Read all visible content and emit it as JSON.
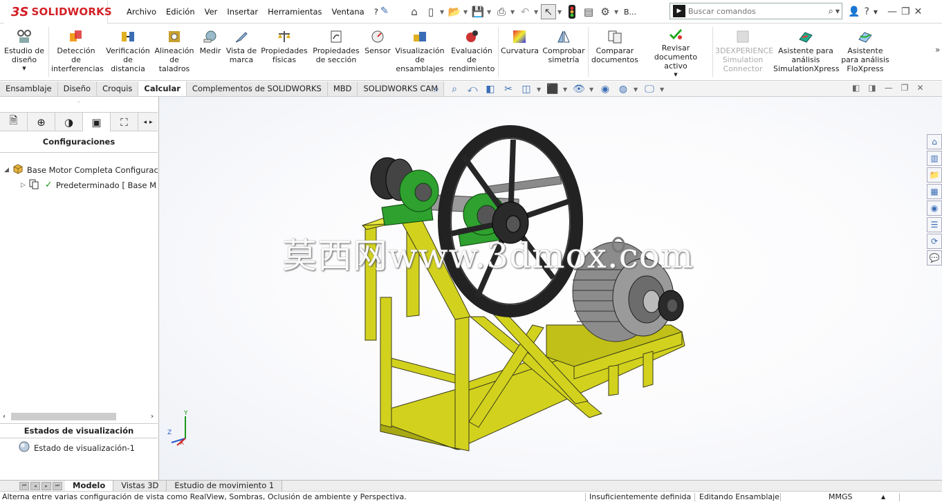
{
  "app": {
    "logo_ds": "3S",
    "logo_name": "SOLIDWORKS"
  },
  "menu": [
    "Archivo",
    "Edición",
    "Ver",
    "Insertar",
    "Herramientas",
    "Ventana",
    "?"
  ],
  "quick_toolbar": {
    "b_label": "B..."
  },
  "search": {
    "placeholder": "Buscar comandos"
  },
  "ribbon": {
    "items": [
      {
        "label": "Estudio de diseño",
        "icon": "design-study-icon"
      },
      {
        "label": "Detección de interferencias",
        "icon": "interference-icon"
      },
      {
        "label": "Verificación de distancia",
        "icon": "clearance-icon"
      },
      {
        "label": "Alineación de taladros",
        "icon": "hole-alignment-icon"
      },
      {
        "label": "Medir",
        "icon": "measure-icon"
      },
      {
        "label": "Vista de marca",
        "icon": "markup-icon"
      },
      {
        "label": "Propiedades físicas",
        "icon": "mass-properties-icon"
      },
      {
        "label": "Propiedades de sección",
        "icon": "section-properties-icon"
      },
      {
        "label": "Sensor",
        "icon": "sensor-icon"
      },
      {
        "label": "Visualización de ensamblajes",
        "icon": "assembly-visualization-icon"
      },
      {
        "label": "Evaluación de rendimiento",
        "icon": "performance-icon"
      },
      {
        "label": "Curvatura",
        "icon": "curvature-icon"
      },
      {
        "label": "Comprobar simetría",
        "icon": "symmetry-icon"
      },
      {
        "label": "Comparar documentos",
        "icon": "compare-icon"
      },
      {
        "label": "Revisar documento activo",
        "icon": "check-document-icon"
      },
      {
        "label": "3DEXPERIENCE Simulation Connector",
        "icon": "3dx-connector-icon"
      },
      {
        "label": "Asistente para análisis SimulationXpress",
        "icon": "simulationxpress-icon"
      },
      {
        "label": "Asistente para análisis FloXpress",
        "icon": "floxpress-icon"
      }
    ]
  },
  "command_tabs": [
    "Ensamblaje",
    "Diseño",
    "Croquis",
    "Calcular",
    "Complementos de SOLIDWORKS",
    "MBD",
    "SOLIDWORKS CAM"
  ],
  "active_command_tab": "Calcular",
  "left_panel": {
    "config_title": "Configuraciones",
    "tree": [
      {
        "label": "Base Motor Completa Configurac",
        "icon": "assembly-icon"
      },
      {
        "label": "Predeterminado [ Base M",
        "icon": "configuration-icon"
      }
    ],
    "display_states_title": "Estados de visualización",
    "display_state": "Estado de visualización-1"
  },
  "viewport": {
    "watermark": "莫西网www.3dmox.com",
    "triad_y": "Y",
    "triad_z": "Z",
    "triad_x": "X"
  },
  "bottom_tabs": [
    "Modelo",
    "Vistas 3D",
    "Estudio de movimiento 1"
  ],
  "active_bottom_tab": "Modelo",
  "status": {
    "message": "Alterna entre varias configuración de vista como RealView, Sombras, Oclusión de ambiente y Perspectiva.",
    "definition": "Insuficientemente definida",
    "mode": "Editando Ensamblaje",
    "units": "MMGS",
    "units_arrow": "▲"
  },
  "colors": {
    "frame": "#d2d21e",
    "bearing": "#2ea12e",
    "pulley": "#262626",
    "brand": "#d32027"
  }
}
